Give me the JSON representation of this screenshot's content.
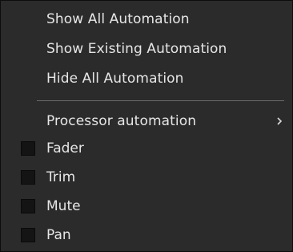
{
  "menu": {
    "items": [
      {
        "label": "Show All Automation"
      },
      {
        "label": "Show Existing Automation"
      },
      {
        "label": "Hide All Automation"
      }
    ],
    "processor_automation_label": "Processor automation",
    "submenu_arrow_icon": "chevron-right-icon",
    "check_items": [
      {
        "label": "Fader",
        "checked": false
      },
      {
        "label": "Trim",
        "checked": false
      },
      {
        "label": "Mute",
        "checked": false
      },
      {
        "label": "Pan",
        "checked": false
      }
    ]
  }
}
